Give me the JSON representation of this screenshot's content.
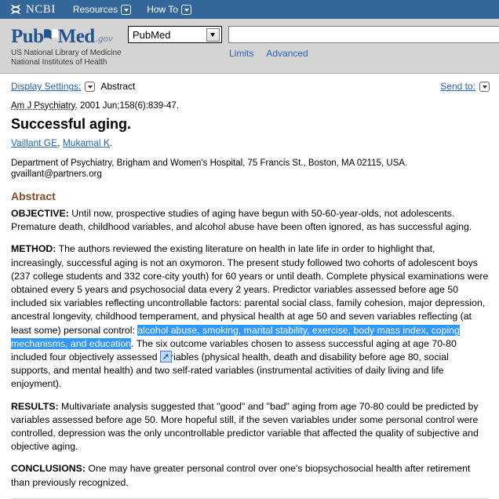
{
  "ncbi_bar": {
    "logo_text": "NCBI",
    "logo_icon": "dna-helix-icon",
    "menu": [
      {
        "label": "Resources",
        "icon": "chevron-down-icon"
      },
      {
        "label": "How To",
        "icon": "chevron-down-icon"
      }
    ]
  },
  "pubmed_banner": {
    "logo": {
      "part1": "Pub",
      "part2": "Med",
      "suffix": ".gov",
      "icon": "open-book-icon"
    },
    "tagline_line1": "US National Library of Medicine",
    "tagline_line2": "National Institutes of Health",
    "database_select": {
      "value": "PubMed",
      "icon": "chevron-down-icon"
    },
    "search_input": {
      "value": "",
      "placeholder": ""
    },
    "links": [
      {
        "label": "Limits"
      },
      {
        "label": "Advanced"
      }
    ]
  },
  "display_bar": {
    "display_settings_label": "Display Settings:",
    "display_settings_icon": "chevron-down-icon",
    "display_settings_value": "Abstract",
    "send_to_label": "Send to:",
    "send_to_icon": "chevron-down-icon"
  },
  "article": {
    "citation_journal": "Am J Psychiatry.",
    "citation_rest": " 2001 Jun;158(6):839-47.",
    "title": "Successful aging.",
    "authors": [
      {
        "name": "Vaillant GE"
      },
      {
        "name": "Mukamal K"
      }
    ],
    "authors_sep": ", ",
    "authors_end": ".",
    "affiliation": "Department of Psychiatry, Brigham and Women's Hospital, 75 Francis St., Boston, MA 02115, USA. gvaillant@partners.org",
    "abstract_heading": "Abstract",
    "paragraphs": [
      {
        "label": "OBJECTIVE:",
        "text": " Until now, prospective studies of aging have begun with 50-60-year-olds, not adolescents. Premature death, childhood variables, and alcohol abuse have been often ignored, as has successful aging."
      },
      {
        "label": "METHOD:",
        "text_before": " The authors reviewed the existing literature on health in late life in order to highlight that, increasingly, successful aging is not an oxymoron. The present study followed two cohorts of adolescent boys (237 college students and 332 core-city youth) for 60 years or until death. Complete physical examinations were obtained every 5 years and psychosocial data every 2 years. Predictor variables assessed before age 50 included six variables reflecting uncontrollable factors: parental social class, family cohesion, major depression, ancestral longevity, childhood temperament, and physical health at age 50 and seven variables reflecting (at least some) personal control: ",
        "selected_text": "alcohol abuse, smoking, marital stability, exercise, body mass index, coping mechanisms, and education",
        "text_after_1": ". The six outcome variables chosen to assess successful aging at age 70-80 included four objectively assessed ",
        "inline_icon": "popup-expand-icon",
        "text_after_2": "variables (physical health, death and disability before age 80, social supports, and mental health) and two self-rated variables (instrumental activities of daily living and life enjoyment)."
      },
      {
        "label": "RESULTS:",
        "text": " Multivariate analysis suggested that \"good\" and \"bad\" aging from age 70-80 could be predicted by variables assessed before age 50. More hopeful still, if the seven variables under some personal control were controlled, depression was the only uncontrollable predictor variable that affected the quality of subjective and objective aging."
      },
      {
        "label": "CONCLUSIONS:",
        "text": " One may have greater personal control over one's biopsychosocial health after retirement than previously recognized."
      }
    ]
  },
  "colors": {
    "header_blue": "#336699",
    "banner_gray": "#d4d4d4",
    "link_blue": "#2a63b5",
    "selection_blue": "#3399ff",
    "abstract_heading_brown": "#8a4b2a",
    "logo_blue": "#24548f"
  }
}
